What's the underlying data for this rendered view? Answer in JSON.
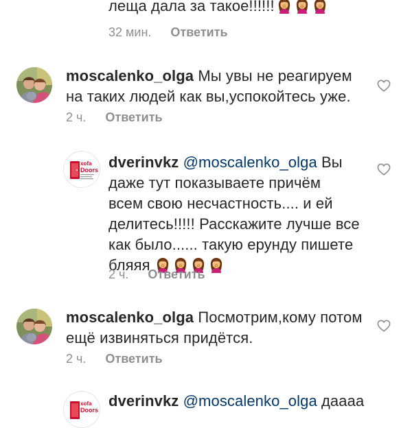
{
  "comments": [
    {
      "text": "леща дала за такое!!!!!!",
      "time": "32 мин.",
      "reply": "Ответить"
    },
    {
      "username": "moscalenko_olga",
      "text_line1": "Мы увы не реагируем",
      "text_line2": "на таких людей как вы,успокойтесь уже.",
      "time": "2 ч.",
      "reply": "Ответить"
    },
    {
      "username": "dverinvkz",
      "mention": "@moscalenko_olga",
      "text_line1_rest": "Вы",
      "text_line2": "даже тут показываете причём",
      "text_line3": "всем свою несчастность.... и ей",
      "text_line4": "делитесь!!!!! Расскажите лучше все",
      "text_line5": "как было...... такую ерунду пишете",
      "text_line6": "бляяя",
      "time": "2 ч.",
      "reply": "Ответить",
      "avatar_label": "Doors"
    },
    {
      "username": "moscalenko_olga",
      "text_line1": "Посмотрим,кому потом",
      "text_line2": "ещё извиняться придётся.",
      "time": "2 ч.",
      "reply": "Ответить"
    },
    {
      "username": "dverinvkz",
      "mention": "@moscalenko_olga",
      "text_line1_rest": "даааа",
      "avatar_label": "Doors"
    }
  ],
  "colors": {
    "mention": "#00376b",
    "meta": "#8e8e8e",
    "text": "#262626"
  },
  "icons": {
    "like": "heart-icon",
    "emoji": "woman-facepalming-emoji"
  }
}
